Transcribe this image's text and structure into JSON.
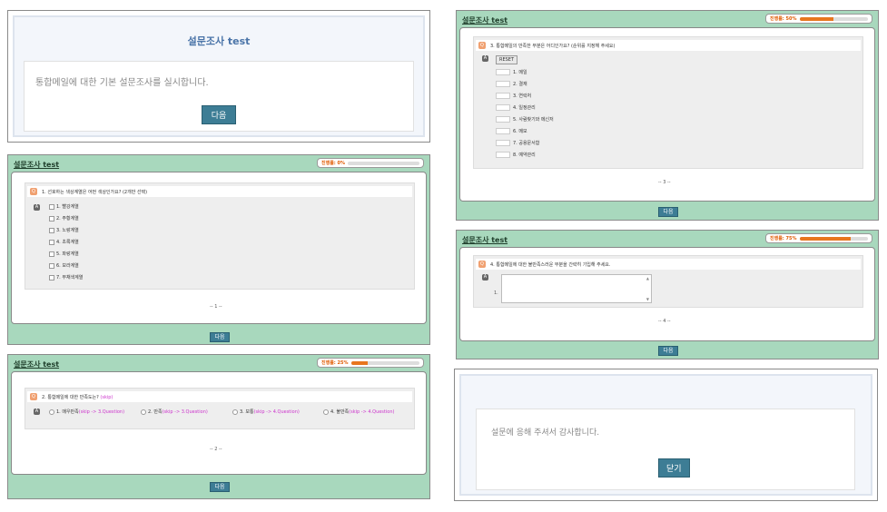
{
  "intro": {
    "title": "설문조사 test",
    "message": "통합메일에 대한 기본 설문조사를 실시합니다.",
    "next_label": "다음"
  },
  "survey_title": "설문조사 test",
  "progress_label_prefix": "진행률:",
  "q1": {
    "progress_text": "진행률: 0%",
    "progress": 0,
    "num": "Q",
    "answer_marker": "A",
    "question": "1. 선호하는 색상계열은 어떤 색상인가요? (2개만 선택)",
    "options": [
      "1. 빨강계열",
      "2. 주황계열",
      "3. 노랑계열",
      "4. 초록계열",
      "5. 파랑계열",
      "6. 보라계열",
      "7. 무채색계열"
    ],
    "page": "-- 1 --",
    "next_label": "다음"
  },
  "q2": {
    "progress_text": "진행률: 25%",
    "progress": 25,
    "num": "Q",
    "answer_marker": "A",
    "question": "2. 통합메일에 대한 만족도는?",
    "question_skip": "(skip)",
    "options": [
      {
        "label": "1. 매우만족",
        "skip": "(skip -> 3.Question)"
      },
      {
        "label": "2. 만족",
        "skip": "(skip -> 3.Question)"
      },
      {
        "label": "3. 보통",
        "skip": "(skip -> 4.Question)"
      },
      {
        "label": "4. 불만족",
        "skip": "(skip -> 4.Question)"
      }
    ],
    "page": "-- 2 --",
    "next_label": "다음"
  },
  "q3": {
    "progress_text": "진행률: 50%",
    "progress": 50,
    "num": "Q",
    "answer_marker": "A",
    "question": "3. 통합메일의 만족한 부분은 어디인가요? (순위를 지정해 주세요)",
    "reset_label": "RESET",
    "options": [
      "1. 메일",
      "2. 결재",
      "3. 연락처",
      "4. 일정관리",
      "5. 사람찾기와 메신저",
      "6. 메모",
      "7. 공용문서함",
      "8. 예약관리"
    ],
    "page": "-- 3 --",
    "next_label": "다음"
  },
  "q4": {
    "progress_text": "진행률: 75%",
    "progress": 75,
    "num": "Q",
    "answer_marker": "A",
    "question": "4. 통합메일에 대한 불만족스러운 부분을 간략히 기입해 주세요.",
    "answer_index": "1.",
    "page": "-- 4 --",
    "next_label": "다음"
  },
  "end": {
    "message": "설문에 응해 주셔서 감사합니다.",
    "close_label": "닫기"
  },
  "colors": {
    "panel_green": "#a8d8bd",
    "button_blue": "#3d7d95",
    "progress_orange": "#e8761e",
    "skip_magenta": "#cc33cc"
  }
}
